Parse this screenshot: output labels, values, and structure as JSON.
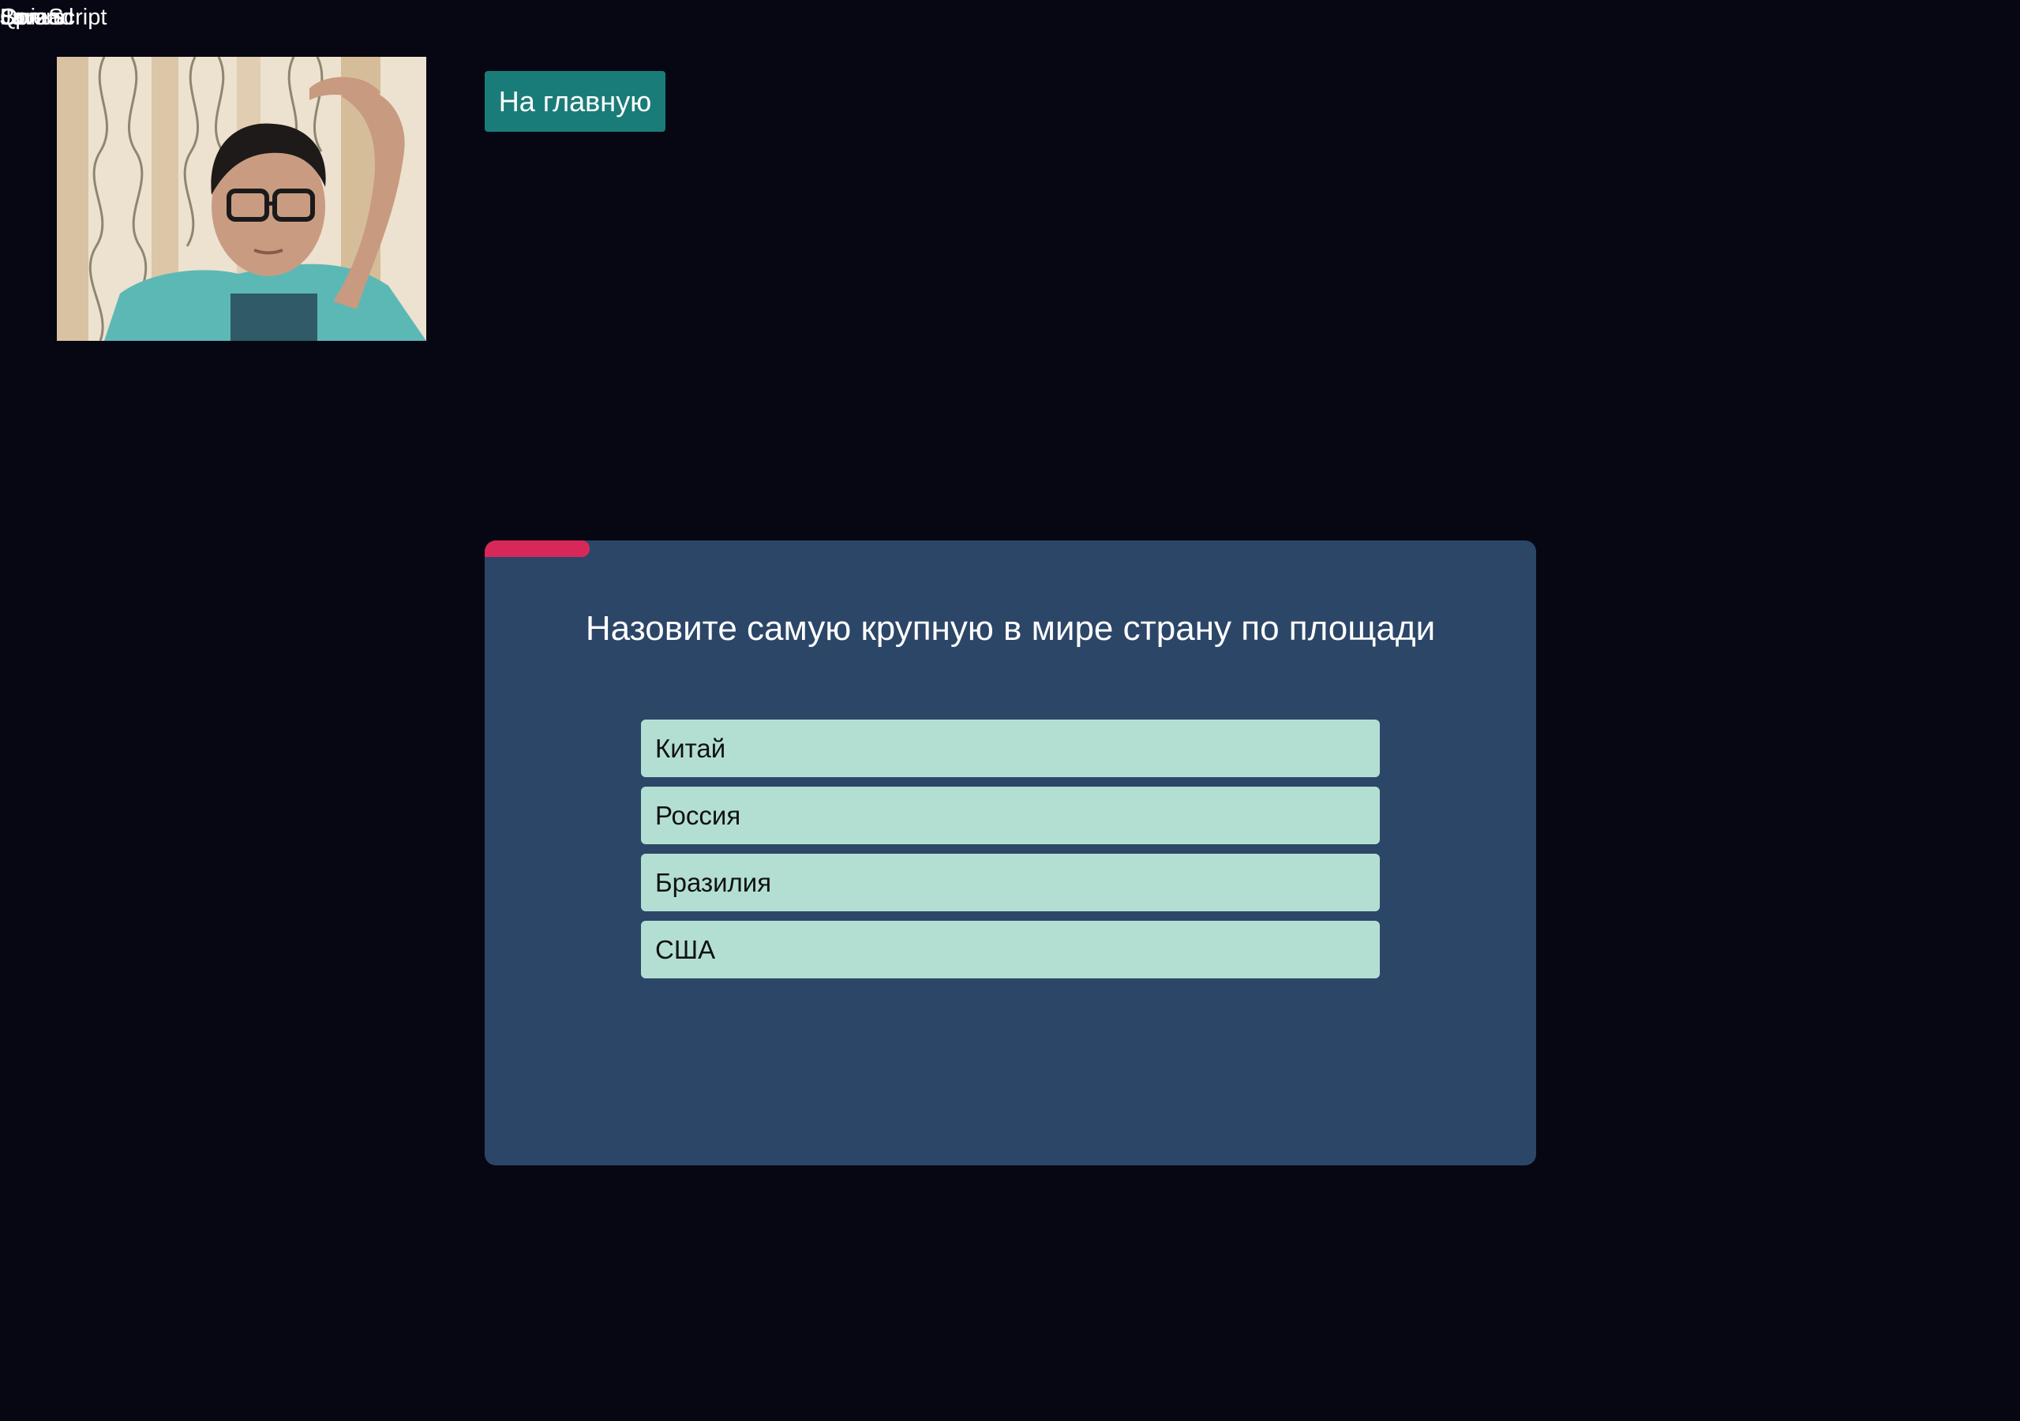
{
  "debug_labels": [
    "JavaScript",
    "Spread",
    "Lorem",
    "Bonus",
    "Quiz"
  ],
  "webcam": {
    "icon": "webcam-video-feed"
  },
  "nav": {
    "home_label": "На главную",
    "home_color": "#1a7c78"
  },
  "quiz": {
    "timer_remaining_fraction": 0.1,
    "timer_color": "#d8285a",
    "card_color": "#2c4668",
    "question": "Назовите самую крупную в мире страну по площади",
    "answers": [
      {
        "label": "Китай"
      },
      {
        "label": "Россия"
      },
      {
        "label": "Бразилия"
      },
      {
        "label": "США"
      }
    ],
    "answer_color": "#b3dfd3"
  }
}
